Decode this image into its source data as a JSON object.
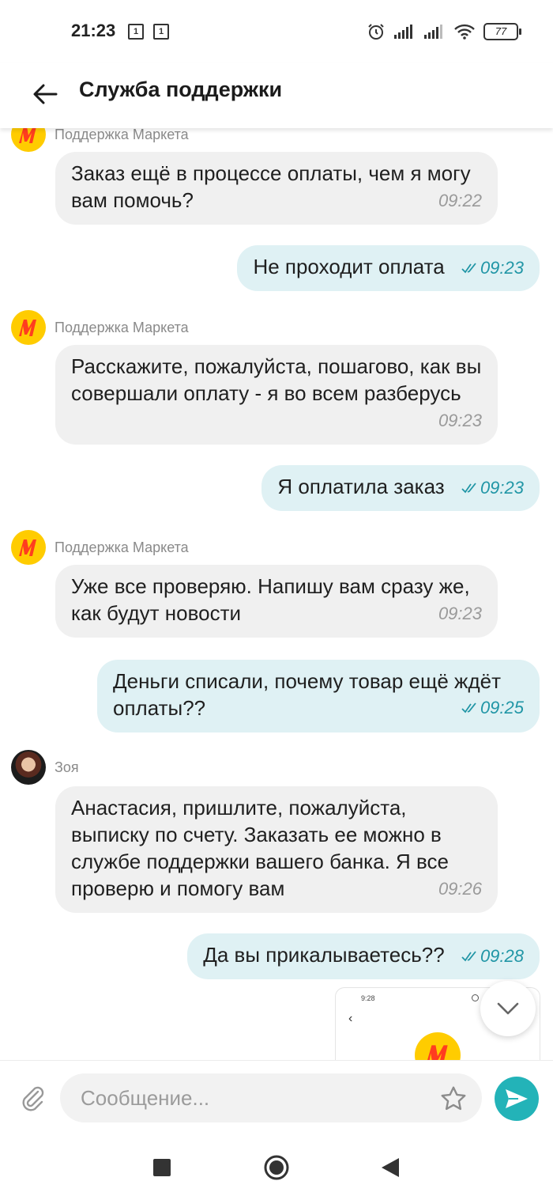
{
  "status_bar": {
    "time": "21:23",
    "sim1": "1",
    "sim2": "1",
    "battery": "77"
  },
  "header": {
    "title": "Служба поддержки"
  },
  "messages": [
    {
      "sender": "Поддержка Маркета",
      "text": "Заказ ещё в процессе оплаты, чем я могу вам помочь?",
      "time": "09:22"
    },
    {
      "text": "Не проходит оплата",
      "time": "09:23"
    },
    {
      "sender": "Поддержка Маркета",
      "text": "Расскажите, пожалуйста, пошагово, как вы совершали оплату - я во всем разберусь",
      "time": "09:23"
    },
    {
      "text": "Я оплатила заказ",
      "time": "09:23"
    },
    {
      "sender": "Поддержка Маркета",
      "text": "Уже все проверяю. Напишу вам сразу же, как будут новости",
      "time": "09:23"
    },
    {
      "text": "Деньги списали, почему товар ещё ждёт оплаты??",
      "time": "09:25"
    },
    {
      "sender": "Зоя",
      "text": "Анастасия, пришлите, пожалуйста, выписку по счету. Заказать ее можно в службе поддержки вашего банка. Я все проверю и помогу вам",
      "time": "09:26"
    },
    {
      "text": "Да вы прикалываетесь??",
      "time": "09:28"
    }
  ],
  "screenshot_preview": {
    "time": "9:28"
  },
  "composer": {
    "placeholder": "Сообщение..."
  },
  "colors": {
    "accent": "#23b3b8",
    "outgoing_bubble": "#dff1f4",
    "incoming_bubble": "#f0f0f0",
    "market_logo": "#ffcc00",
    "market_logo_letter": "#ff3d1f"
  },
  "icons": [
    "back-arrow-icon",
    "market-logo-icon",
    "double-check-icon",
    "chevron-down-icon",
    "paperclip-icon",
    "star-icon",
    "send-icon",
    "nav-square-icon",
    "nav-circle-icon",
    "nav-triangle-icon"
  ]
}
